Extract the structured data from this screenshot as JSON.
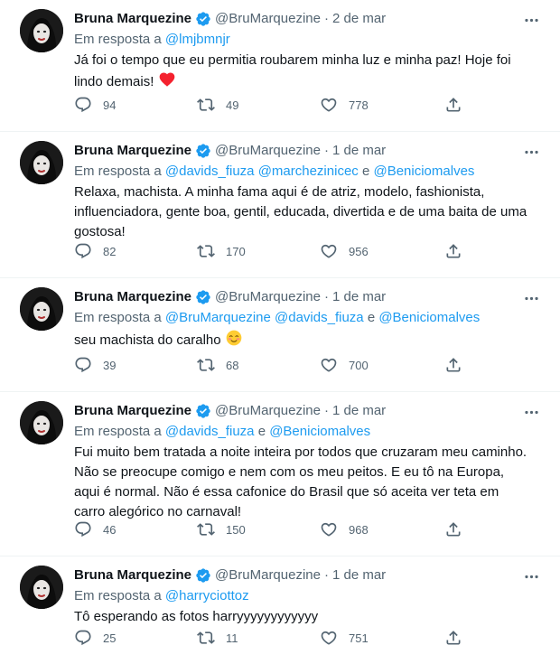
{
  "colors": {
    "text": "#0f1419",
    "muted": "#536471",
    "link": "#1d9bf0",
    "verified": "#1d9bf0",
    "divider": "#eff3f4",
    "heart": "#f4212e"
  },
  "tweets": [
    {
      "name": "Bruna Marquezine",
      "handle": "@BruMarquezine",
      "dot": "·",
      "time": "2 de mar",
      "reply_prefix": "Em resposta a",
      "mentions": [
        "@lmjbmnjr"
      ],
      "mention_joiner": "",
      "text": "Já foi o tempo que eu permitia roubarem minha luz e minha paz! Hoje foi lindo demais!",
      "emoji": "red-heart-icon",
      "replies": "94",
      "retweets": "49",
      "likes": "778"
    },
    {
      "name": "Bruna Marquezine",
      "handle": "@BruMarquezine",
      "dot": "·",
      "time": "1 de mar",
      "reply_prefix": "Em resposta a",
      "mentions": [
        "@davids_fiuza",
        "@marchezinicec",
        "@Beniciomalves"
      ],
      "mention_joiner": "e",
      "text": "Relaxa, machista. A minha fama aqui é de atriz, modelo, fashionista, influenciadora, gente boa, gentil, educada, divertida e de uma baita de uma gostosa!",
      "replies": "82",
      "retweets": "170",
      "likes": "956"
    },
    {
      "name": "Bruna Marquezine",
      "handle": "@BruMarquezine",
      "dot": "·",
      "time": "1 de mar",
      "reply_prefix": "Em resposta a",
      "mentions": [
        "@BruMarquezine",
        "@davids_fiuza",
        "@Beniciomalves"
      ],
      "mention_joiner": "e",
      "text": "seu machista do caralho",
      "emoji": "blushing-smile-icon",
      "replies": "39",
      "retweets": "68",
      "likes": "700"
    },
    {
      "name": "Bruna Marquezine",
      "handle": "@BruMarquezine",
      "dot": "·",
      "time": "1 de mar",
      "reply_prefix": "Em resposta a",
      "mentions": [
        "@davids_fiuza",
        "@Beniciomalves"
      ],
      "mention_joiner": "e",
      "text": "Fui muito bem tratada a noite inteira por todos que cruzaram meu caminho. Não se preocupe comigo e nem com os meu peitos. E eu tô na Europa, aqui é normal. Não é essa cafonice do Brasil que só aceita ver teta em carro alegórico no carnaval!",
      "replies": "46",
      "retweets": "150",
      "likes": "968"
    },
    {
      "name": "Bruna Marquezine",
      "handle": "@BruMarquezine",
      "dot": "·",
      "time": "1 de mar",
      "reply_prefix": "Em resposta a",
      "mentions": [
        "@harryciottoz"
      ],
      "mention_joiner": "",
      "text": "Tô esperando as fotos harryyyyyyyyyyyy",
      "replies": "25",
      "retweets": "11",
      "likes": "751"
    }
  ]
}
